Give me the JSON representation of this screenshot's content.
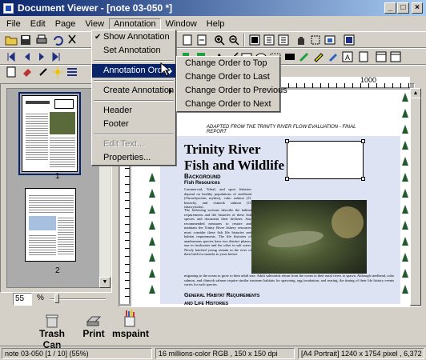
{
  "window": {
    "title": "Document Viewer - [note 03-050 *]"
  },
  "menubar": [
    "File",
    "Edit",
    "Page",
    "View",
    "Annotation",
    "Window",
    "Help"
  ],
  "annotation_menu": {
    "items": [
      {
        "label": "Show Annotation",
        "checked": true
      },
      {
        "label": "Set Annotation"
      },
      {
        "label": "Annotation Order",
        "submenu": true,
        "highlighted": true
      },
      {
        "label": "Create Annotation",
        "submenu": true
      },
      {
        "label": "Header"
      },
      {
        "label": "Footer"
      },
      {
        "label": "Edit Text...",
        "disabled": true
      },
      {
        "label": "Properties..."
      }
    ]
  },
  "order_submenu": {
    "items": [
      "Change Order to Top",
      "Change Order to Last",
      "Change Order to Previous",
      "Change Order to Next"
    ]
  },
  "thumbnails": {
    "labels": [
      "1",
      "2"
    ]
  },
  "zoom": {
    "value": "55",
    "unit": "%"
  },
  "ruler": {
    "mark": "1000"
  },
  "document": {
    "header": "ADAPTED FROM  THE TRINITY RIVER FLOW EVALUATION - FINAL REPORT",
    "title_line1": "Trinity River",
    "title_line2": "Fish and Wildlife",
    "section": "Background",
    "subsection": "Fish Resources",
    "para1": "Commercial, Tribal, and sport fisheries depend on healthy populations of steelhead (Oncorhynchus mykiss), coho salmon (O. kisutch), and chinook salmon (O. tshawytscha).",
    "para2": "The following sections describe the habitat requirements and life histories of these fish species and document their declines. Any recommended measures to restore and maintain the Trinity River fishery resources must consider these fish life histories and habitat requirements. The life histories of anadromous species have two distinct phases, one in freshwater and the other in salt water. Newly hatched young remain in the river of their birth for months to years before",
    "para3": "migrating to the ocean to grow to their adult size. Adult salmonids return from the ocean to their natal rivers to spawn. Although steelhead, coho salmon, and chinook salmon require similar instream habitats for spawning, egg incubation, and rearing, the timing of their life history events varies for each species.",
    "section2_line1": "General Habitat Requirements",
    "section2_line2": "and Life Histories"
  },
  "dock": [
    {
      "label": "Trash Can",
      "icon": "trash-can-icon"
    },
    {
      "label": "Print",
      "icon": "printer-icon"
    },
    {
      "label": "mspaint",
      "icon": "paint-icon"
    }
  ],
  "status": {
    "file": "note 03-050 [1 / 10] (55%)",
    "color": "16 millions-color RGB ,  150 x 150 dpi",
    "page": "[A4 Portrait]  1240 x 1754 pixel , 6,372"
  }
}
